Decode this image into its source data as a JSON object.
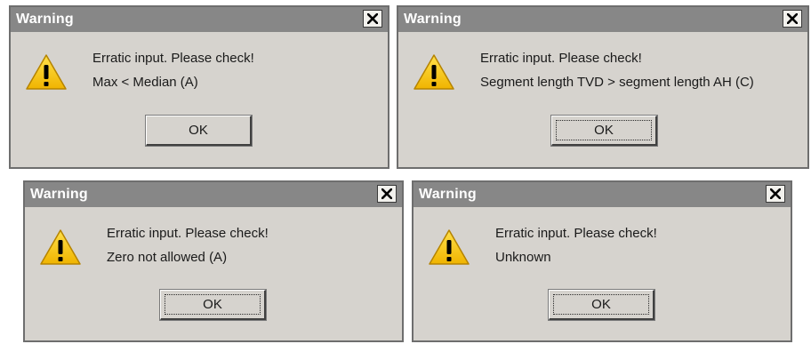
{
  "dialogs": [
    {
      "title": "Warning",
      "line1": "Erratic input. Please check!",
      "line2": "Max < Median (A)",
      "ok_label": "OK",
      "ok_focused": false
    },
    {
      "title": "Warning",
      "line1": "Erratic input. Please check!",
      "line2": "Segment length TVD > segment length AH (C)",
      "ok_label": "OK",
      "ok_focused": true
    },
    {
      "title": "Warning",
      "line1": "Erratic input. Please check!",
      "line2": "Zero not allowed (A)",
      "ok_label": "OK",
      "ok_focused": true
    },
    {
      "title": "Warning",
      "line1": "Erratic input. Please check!",
      "line2": "Unknown",
      "ok_label": "OK",
      "ok_focused": true
    }
  ],
  "icons": {
    "warning": "warning-triangle-icon",
    "close": "close-x-icon"
  },
  "colors": {
    "dialog_bg": "#d6d3ce",
    "titlebar_bg": "#878787",
    "title_text": "#ffffff",
    "warning_yellow": "#f5c400"
  }
}
